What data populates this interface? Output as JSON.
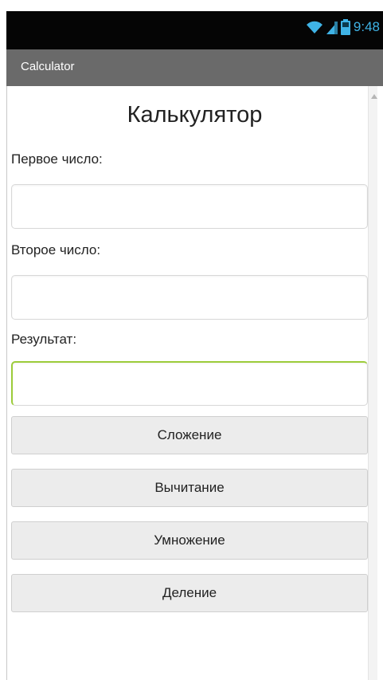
{
  "status_bar": {
    "time": "9:48",
    "icons": [
      "wifi-icon",
      "signal-icon",
      "battery-icon"
    ],
    "time_color": "#3fb3e6"
  },
  "action_bar": {
    "title": "Calculator"
  },
  "form": {
    "title": "Калькулятор",
    "first_label": "Первое число:",
    "first_value": "",
    "second_label": "Второе число:",
    "second_value": "",
    "result_label": "Результат:",
    "result_value": ""
  },
  "buttons": {
    "add": "Сложение",
    "subtract": "Вычитание",
    "multiply": "Умножение",
    "divide": "Деление"
  },
  "colors": {
    "status_bg": "#050505",
    "action_bar_bg": "#6a6a6a",
    "active_field_accent": "#9ccc3a",
    "button_bg": "#ececec"
  }
}
